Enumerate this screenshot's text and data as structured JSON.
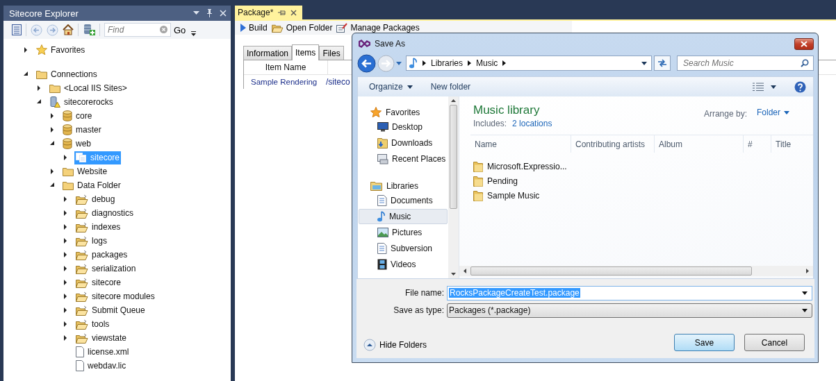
{
  "explorer": {
    "title": "Sitecore Explorer",
    "find": {
      "placeholder": "Find"
    },
    "go": "Go"
  },
  "tree": [
    {
      "label": "Favorites",
      "kind": "star",
      "expanded": false,
      "selected": false
    },
    {
      "label": "Connections",
      "kind": "folder",
      "expanded": true,
      "selected": false,
      "children": [
        {
          "label": "<Local IIS Sites>",
          "kind": "folder",
          "expanded": false,
          "selected": false
        },
        {
          "label": "sitecorerocks",
          "kind": "server",
          "expanded": true,
          "selected": false,
          "children": [
            {
              "label": "core",
              "kind": "database",
              "expanded": false,
              "selected": false
            },
            {
              "label": "master",
              "kind": "database",
              "expanded": false,
              "selected": false
            },
            {
              "label": "web",
              "kind": "database",
              "expanded": true,
              "selected": false,
              "children": [
                {
                  "label": "sitecore",
                  "kind": "item",
                  "expanded": false,
                  "selected": true
                }
              ]
            },
            {
              "label": "Website",
              "kind": "folder",
              "expanded": false,
              "selected": false
            },
            {
              "label": "Data Folder",
              "kind": "folder",
              "expanded": true,
              "selected": false,
              "children": [
                {
                  "label": "debug",
                  "kind": "openfolder",
                  "expanded": false,
                  "selected": false
                },
                {
                  "label": "diagnostics",
                  "kind": "openfolder",
                  "expanded": false,
                  "selected": false
                },
                {
                  "label": "indexes",
                  "kind": "openfolder",
                  "expanded": false,
                  "selected": false
                },
                {
                  "label": "logs",
                  "kind": "openfolder",
                  "expanded": false,
                  "selected": false
                },
                {
                  "label": "packages",
                  "kind": "openfolder",
                  "expanded": false,
                  "selected": false
                },
                {
                  "label": "serialization",
                  "kind": "openfolder",
                  "expanded": false,
                  "selected": false
                },
                {
                  "label": "sitecore",
                  "kind": "openfolder",
                  "expanded": false,
                  "selected": false
                },
                {
                  "label": "sitecore modules",
                  "kind": "openfolder",
                  "expanded": false,
                  "selected": false
                },
                {
                  "label": "Submit Queue",
                  "kind": "openfolder",
                  "expanded": false,
                  "selected": false
                },
                {
                  "label": "tools",
                  "kind": "openfolder",
                  "expanded": false,
                  "selected": false
                },
                {
                  "label": "viewstate",
                  "kind": "openfolder",
                  "expanded": false,
                  "selected": false
                },
                {
                  "label": "license.xml",
                  "kind": "file",
                  "selected": false
                },
                {
                  "label": "webdav.lic",
                  "kind": "file",
                  "selected": false
                }
              ]
            }
          ]
        }
      ]
    }
  ],
  "document": {
    "tab": "Package*",
    "toolbar": [
      {
        "label": "Build",
        "kind": "play"
      },
      {
        "label": "Open Folder",
        "kind": "openfolder"
      },
      {
        "label": "Manage Packages",
        "kind": "edit"
      }
    ],
    "tabs": [
      {
        "label": "Information",
        "selected": false
      },
      {
        "label": "Items",
        "selected": true
      },
      {
        "label": "Files",
        "selected": false
      }
    ],
    "table": {
      "columns": [
        "Item Name"
      ],
      "rows": [
        [
          "Sample Rendering",
          "/siteco"
        ]
      ]
    }
  },
  "dialog": {
    "title": "Save As",
    "breadcrumbs": [
      "Libraries",
      "Music"
    ],
    "search": {
      "placeholder": "Search Music"
    },
    "commands": [
      {
        "label": "Organize",
        "menu": true
      },
      {
        "label": "New folder",
        "menu": false
      }
    ],
    "nav": [
      {
        "label": "Favorites",
        "kind": "star",
        "items": [
          {
            "label": "Desktop",
            "kind": "desktop",
            "selected": false
          },
          {
            "label": "Downloads",
            "kind": "downloads",
            "selected": false
          },
          {
            "label": "Recent Places",
            "kind": "recent",
            "selected": false
          }
        ]
      },
      {
        "label": "Libraries",
        "kind": "libraries",
        "items": [
          {
            "label": "Documents",
            "kind": "documents",
            "selected": false
          },
          {
            "label": "Music",
            "kind": "music",
            "selected": true
          },
          {
            "label": "Pictures",
            "kind": "pictures",
            "selected": false
          },
          {
            "label": "Subversion",
            "kind": "documents",
            "selected": false
          },
          {
            "label": "Videos",
            "kind": "videos",
            "selected": false
          }
        ]
      }
    ],
    "library": {
      "title": "Music library",
      "includes_label": "Includes:",
      "includes_link": "2 locations",
      "arrange_label": "Arrange by:",
      "arrange_value": "Folder"
    },
    "columns": [
      "Name",
      "Contributing artists",
      "Album",
      "#",
      "Title"
    ],
    "files": [
      "Microsoft.Expressio...",
      "Pending",
      "Sample Music"
    ],
    "file_name": {
      "label": "File name:",
      "value": "RocksPackageCreateTest.package"
    },
    "save_type": {
      "label": "Save as type:",
      "value": "Packages (*.package)"
    },
    "hide_folders": "Hide Folders",
    "buttons": [
      {
        "label": "Save",
        "default": true
      },
      {
        "label": "Cancel",
        "default": false
      }
    ]
  }
}
